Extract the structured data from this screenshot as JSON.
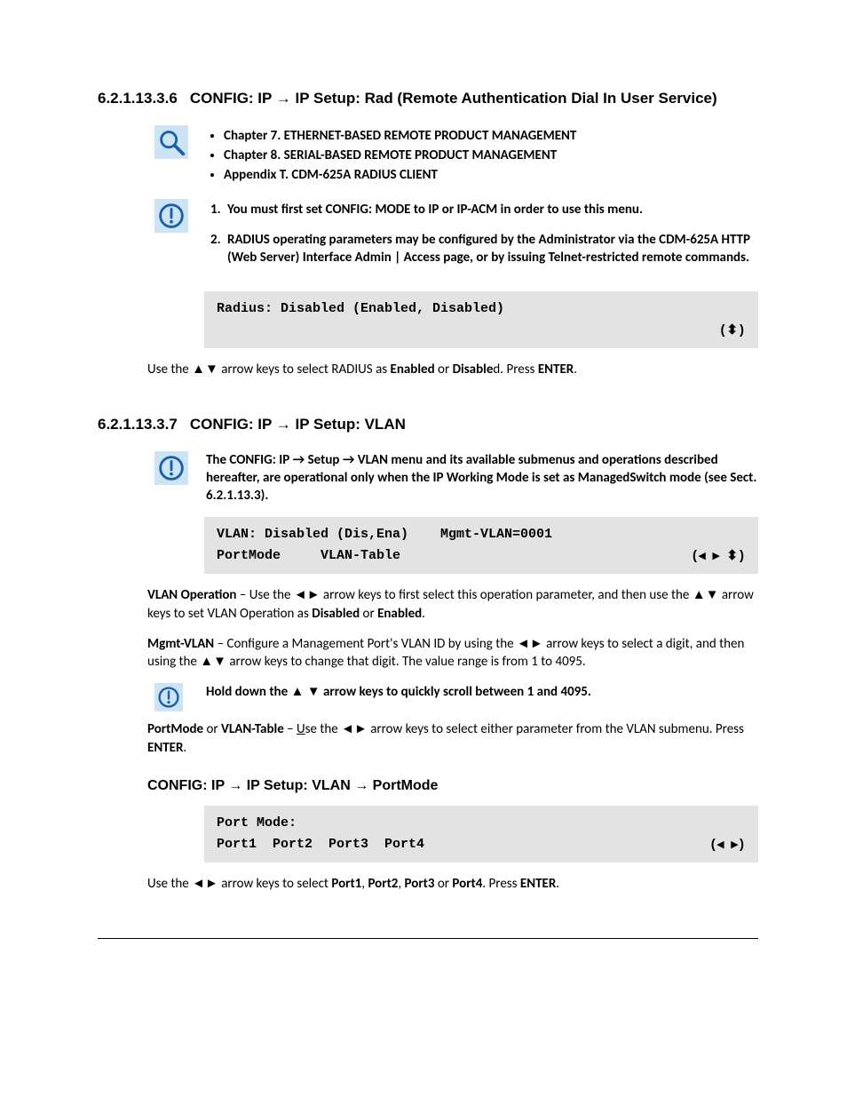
{
  "section1": {
    "number": "6.2.1.13.3.6",
    "title": "CONFIG: IP → IP Setup: Rad (Remote Authentication Dial In User Service)",
    "bullets": [
      "Chapter 7. ETHERNET-BASED REMOTE PRODUCT MANAGEMENT",
      "Chapter 8. SERIAL-BASED REMOTE PRODUCT MANAGEMENT",
      "Appendix T. CDM-625A RADIUS CLIENT"
    ],
    "notes": [
      "You must first set CONFIG: MODE to IP or IP-ACM in order to use this menu.",
      "RADIUS operating parameters may be configured by the Administrator via the CDM-625A HTTP (Web Server) Interface Admin | Access page, or by issuing Telnet-restricted remote commands."
    ],
    "terminal_line": "Radius: Disabled (Enabled, Disabled)",
    "terminal_nav": "(⬍)",
    "post_text_1": "Use the ▲▼ arrow keys to select RADIUS as ",
    "post_bold_1": "Enabled",
    "post_text_2": " or ",
    "post_bold_2": "Disable",
    "post_text_3": "d. Press ",
    "post_bold_3": "ENTER",
    "post_text_4": "."
  },
  "section2": {
    "number": "6.2.1.13.3.7",
    "title": "CONFIG: IP → IP Setup: VLAN",
    "note": "The CONFIG: IP → Setup → VLAN menu and its available submenus and operations described hereafter, are operational only when the IP Working Mode is set as ManagedSwitch mode (see Sect. 6.2.1.13.3).",
    "terminal_l1": "VLAN: Disabled (Dis,Ena)    Mgmt-VLAN=0001",
    "terminal_l2a": "PortMode     VLAN-Table",
    "terminal_nav": "(◂ ▸ ⬍)",
    "p1_b1": "VLAN Operation",
    "p1_t1": " – Use the ◄► arrow keys to first select this operation parameter, and then use the ▲▼ arrow keys to set VLAN Operation as ",
    "p1_b2": "Disabled",
    "p1_t2": " or ",
    "p1_b3": "Enabled",
    "p1_t3": ".",
    "p2_b1": "Mgmt-VLAN",
    "p2_t1": " – Configure a Management Port's VLAN ID by using the ◄► arrow keys to select a digit, and then using the ▲▼ arrow keys to change that digit. The value range is from 1 to 4095.",
    "note2": "Hold down the ▲ ▼ arrow keys to quickly scroll between 1 and 4095.",
    "p3_b1": "PortMode",
    "p3_t1": " or ",
    "p3_b2": "VLAN-Table",
    "p3_t2": " – ",
    "p3_u": "U",
    "p3_t3": "se the ◄► arrow keys to select either parameter from the VLAN submenu. Press ",
    "p3_b3": "ENTER",
    "p3_t4": "."
  },
  "section3": {
    "title": "CONFIG: IP → IP Setup: VLAN → PortMode",
    "terminal_l1": "Port Mode:",
    "terminal_l2": "Port1  Port2  Port3  Port4",
    "terminal_nav": "(◂ ▸)",
    "post_t1": "Use the ◄► arrow keys to select ",
    "post_b1": "Port1",
    "post_t2": ", ",
    "post_b2": "Port2",
    "post_t3": ", ",
    "post_b3": "Port3",
    "post_t4": " or ",
    "post_b4": "Port4",
    "post_t5": ". Press ",
    "post_b5": "ENTER",
    "post_t6": "."
  }
}
